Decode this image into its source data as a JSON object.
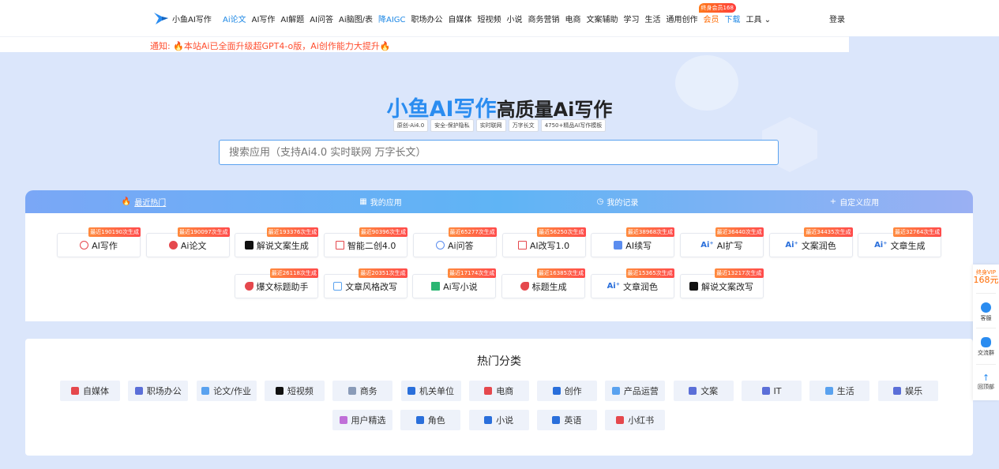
{
  "header": {
    "logo_text": "小鱼AI写作",
    "nav": [
      {
        "label": "Ai论文",
        "style": "blue"
      },
      {
        "label": "AI写作",
        "style": ""
      },
      {
        "label": "AI解题",
        "style": ""
      },
      {
        "label": "AI问答",
        "style": ""
      },
      {
        "label": "Ai脑图/表",
        "style": ""
      },
      {
        "label": "降AIGC",
        "style": "blue"
      },
      {
        "label": "职场办公",
        "style": ""
      },
      {
        "label": "自媒体",
        "style": ""
      },
      {
        "label": "短视频",
        "style": ""
      },
      {
        "label": "小说",
        "style": ""
      },
      {
        "label": "商务营销",
        "style": ""
      },
      {
        "label": "电商",
        "style": ""
      },
      {
        "label": "文案辅助",
        "style": ""
      },
      {
        "label": "学习",
        "style": ""
      },
      {
        "label": "生活",
        "style": ""
      },
      {
        "label": "通用创作",
        "style": ""
      },
      {
        "label": "会员",
        "style": "orange"
      },
      {
        "label": "下载",
        "style": "blue"
      },
      {
        "label": "工具 ⌄",
        "style": ""
      }
    ],
    "vip_badge": "终身会员168",
    "login": "登录"
  },
  "notice": "通知: 🔥本站Ai已全面升级超GPT4-o版，Ai创作能力大提升🔥",
  "hero": {
    "title_blue": "小鱼AI写作",
    "title_black": "高质量Ai写作",
    "tags": [
      "原创-Ai4.0",
      "安全-保护隐私",
      "实时联网",
      "万字长文",
      "4750+精品AI写作模板"
    ],
    "search_placeholder": "搜索应用（支持Ai4.0 实时联网 万字长文）"
  },
  "tabs": [
    {
      "label": "最近热门",
      "icon": "fire-icon"
    },
    {
      "label": "我的应用",
      "icon": "grid-icon"
    },
    {
      "label": "我的记录",
      "icon": "clock-icon"
    },
    {
      "label": "自定义应用",
      "icon": "plus-icon"
    }
  ],
  "apps": [
    {
      "label": "AI写作",
      "badge": "最近190190次生成",
      "icon": "ic-round"
    },
    {
      "label": "Ai论文",
      "badge": "最近190097次生成",
      "icon": "ic-pink"
    },
    {
      "label": "解说文案生成",
      "badge": "最近193376次生成",
      "icon": "ic-tiktok"
    },
    {
      "label": "智能二创4.0",
      "badge": "最近90396次生成",
      "icon": "ic-sq"
    },
    {
      "label": "Ai问答",
      "badge": "最近65277次生成",
      "icon": "ic-swirl"
    },
    {
      "label": "AI改写1.0",
      "badge": "最近56250次生成",
      "icon": "ic-sq"
    },
    {
      "label": "AI续写",
      "badge": "最近38968次生成",
      "icon": "ic-blue"
    },
    {
      "label": "AI扩写",
      "badge": "最近36440次生成",
      "icon": "ic-ai"
    },
    {
      "label": "文案润色",
      "badge": "最近34435次生成",
      "icon": "ic-ai"
    },
    {
      "label": "文章生成",
      "badge": "最近32764次生成",
      "icon": "ic-ai"
    },
    {
      "label": "爆文标题助手",
      "badge": "最近26118次生成",
      "icon": "ic-tag"
    },
    {
      "label": "文章风格改写",
      "badge": "最近20351次生成",
      "icon": "ic-lblue"
    },
    {
      "label": "Ai写小说",
      "badge": "最近17174次生成",
      "icon": "ic-book"
    },
    {
      "label": "标题生成",
      "badge": "最近16385次生成",
      "icon": "ic-tag"
    },
    {
      "label": "文章润色",
      "badge": "最近15365次生成",
      "icon": "ic-ai"
    },
    {
      "label": "解说文案改写",
      "badge": "最近13217次生成",
      "icon": "ic-tiktok"
    }
  ],
  "categories": {
    "title": "热门分类",
    "items": [
      {
        "label": "自媒体",
        "color": "#e5484d"
      },
      {
        "label": "职场办公",
        "color": "#5b6fd8"
      },
      {
        "label": "论文/作业",
        "color": "#5aa2ef"
      },
      {
        "label": "短视频",
        "color": "#111111"
      },
      {
        "label": "商务",
        "color": "#8a9bb8"
      },
      {
        "label": "机关单位",
        "color": "#2a6fdb"
      },
      {
        "label": "电商",
        "color": "#e5484d"
      },
      {
        "label": "创作",
        "color": "#2a6fdb"
      },
      {
        "label": "产品运营",
        "color": "#5aa2ef"
      },
      {
        "label": "文案",
        "color": "#5b6fd8"
      },
      {
        "label": "IT",
        "color": "#5b6fd8"
      },
      {
        "label": "生活",
        "color": "#5aa2ef"
      },
      {
        "label": "娱乐",
        "color": "#5b6fd8"
      },
      {
        "label": "用户精选",
        "color": "#c06fd8"
      },
      {
        "label": "角色",
        "color": "#2a6fdb"
      },
      {
        "label": "小说",
        "color": "#2a6fdb"
      },
      {
        "label": "英语",
        "color": "#2a6fdb"
      },
      {
        "label": "小红书",
        "color": "#e5484d"
      }
    ]
  },
  "float": {
    "vip_line1": "终身VIP",
    "vip_price": "168元",
    "service": "客服",
    "group": "交流群",
    "top": "回顶部"
  }
}
